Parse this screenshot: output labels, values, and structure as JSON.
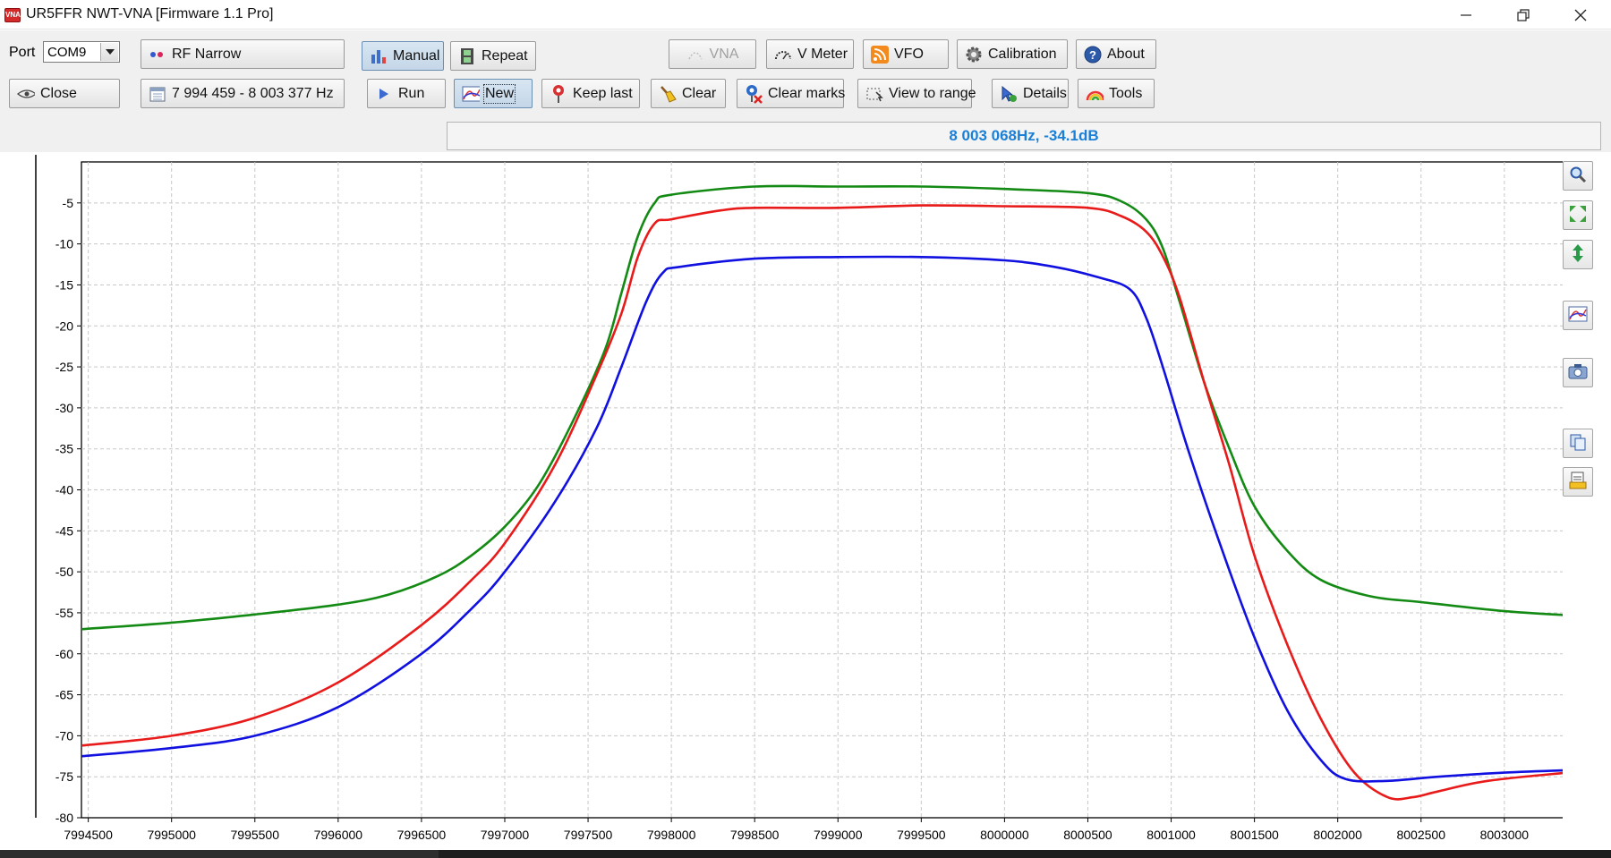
{
  "window": {
    "title": "UR5FFR NWT-VNA [Firmware 1.1 Pro]",
    "icon_text": "VNA"
  },
  "toolbar": {
    "port_label": "Port",
    "port_value": "COM9",
    "mode": "RF Narrow",
    "manual": "Manual",
    "repeat": "Repeat",
    "vna": "VNA",
    "vmeter": "V Meter",
    "vfo": "VFO",
    "calibration": "Calibration",
    "about": "About",
    "close": "Close",
    "range": "7 994 459 - 8 003 377 Hz",
    "run": "Run",
    "new": "New",
    "keep_last": "Keep last",
    "clear": "Clear",
    "clear_marks": "Clear marks",
    "view_to_range": "View to range",
    "details": "Details",
    "tools": "Tools"
  },
  "status": {
    "marker_readout": "8 003 068Hz, -34.1dB",
    "color": "#1a7fd6"
  },
  "colors": {
    "green": "#138a13",
    "red": "#e81a1a",
    "blue": "#1010e0",
    "grid": "#c8c8c8"
  },
  "chart_data": {
    "type": "line",
    "xlim": [
      7994459,
      7994459
    ],
    "ylim": [
      -80,
      0
    ],
    "x_ticks": [
      7994500,
      7995000,
      7995500,
      7996000,
      7996500,
      7997000,
      7997500,
      7998000,
      7998500,
      7999000,
      7999500,
      8000000,
      8000500,
      8001000,
      8001500,
      8002000,
      8002500,
      8003000
    ],
    "x_tick_labels": [
      "7994500",
      "7995000",
      "7995500",
      "7996000",
      "7996500",
      "7997000",
      "7997500",
      "7998000",
      "7998500",
      "7999000",
      "7999500",
      "8000000",
      "8000500",
      "8001000",
      "8001500",
      "8002000",
      "8002500",
      "8003000"
    ],
    "y_ticks": [
      -5,
      -10,
      -15,
      -20,
      -25,
      -30,
      -35,
      -40,
      -45,
      -50,
      -55,
      -60,
      -65,
      -70,
      -75,
      -80
    ],
    "y_tick_labels": [
      "-5",
      "-10",
      "-15",
      "-20",
      "-25",
      "-30",
      "-35",
      "-40",
      "-45",
      "-50",
      "-55",
      "-60",
      "-65",
      "-70",
      "-75",
      "-80"
    ],
    "grid": true,
    "series": [
      {
        "color": "#138a13",
        "points": [
          [
            7994459,
            -57.0
          ],
          [
            7995000,
            -56.2
          ],
          [
            7995500,
            -55.2
          ],
          [
            7996000,
            -54.0
          ],
          [
            7996300,
            -52.8
          ],
          [
            7996600,
            -50.5
          ],
          [
            7996800,
            -48.0
          ],
          [
            7997000,
            -44.5
          ],
          [
            7997200,
            -39.5
          ],
          [
            7997400,
            -32.0
          ],
          [
            7997600,
            -23.0
          ],
          [
            7997700,
            -16.0
          ],
          [
            7997800,
            -9.0
          ],
          [
            7997900,
            -5.0
          ],
          [
            7998000,
            -4.0
          ],
          [
            7998500,
            -3.0
          ],
          [
            7999000,
            -3.0
          ],
          [
            7999500,
            -3.0
          ],
          [
            8000000,
            -3.3
          ],
          [
            8000500,
            -3.8
          ],
          [
            8000700,
            -4.8
          ],
          [
            8000850,
            -7.0
          ],
          [
            8000950,
            -10.5
          ],
          [
            8001050,
            -17.0
          ],
          [
            8001200,
            -27.0
          ],
          [
            8001350,
            -35.0
          ],
          [
            8001500,
            -42.0
          ],
          [
            8001700,
            -47.5
          ],
          [
            8001900,
            -51.0
          ],
          [
            8002200,
            -53.0
          ],
          [
            8002500,
            -53.7
          ],
          [
            8003000,
            -54.8
          ],
          [
            8003377,
            -55.3
          ]
        ]
      },
      {
        "color": "#e81a1a",
        "points": [
          [
            7994459,
            -71.2
          ],
          [
            7995000,
            -70.0
          ],
          [
            7995500,
            -67.8
          ],
          [
            7996000,
            -63.5
          ],
          [
            7996500,
            -56.5
          ],
          [
            7996800,
            -51.0
          ],
          [
            7997000,
            -46.5
          ],
          [
            7997300,
            -37.0
          ],
          [
            7997550,
            -26.0
          ],
          [
            7997700,
            -18.5
          ],
          [
            7997800,
            -11.5
          ],
          [
            7997900,
            -7.5
          ],
          [
            7998000,
            -7.0
          ],
          [
            7998300,
            -5.9
          ],
          [
            7998500,
            -5.6
          ],
          [
            7999000,
            -5.6
          ],
          [
            7999500,
            -5.3
          ],
          [
            8000000,
            -5.4
          ],
          [
            8000500,
            -5.6
          ],
          [
            8000700,
            -6.6
          ],
          [
            8000850,
            -8.5
          ],
          [
            8000950,
            -11.5
          ],
          [
            8001050,
            -16.5
          ],
          [
            8001200,
            -27.0
          ],
          [
            8001350,
            -37.0
          ],
          [
            8001500,
            -48.0
          ],
          [
            8001700,
            -59.0
          ],
          [
            8001900,
            -68.0
          ],
          [
            8002100,
            -74.5
          ],
          [
            8002300,
            -77.5
          ],
          [
            8002450,
            -77.5
          ],
          [
            8002600,
            -76.8
          ],
          [
            8002900,
            -75.5
          ],
          [
            8003377,
            -74.5
          ]
        ]
      },
      {
        "color": "#1010e0",
        "points": [
          [
            7994459,
            -72.5
          ],
          [
            7995000,
            -71.5
          ],
          [
            7995500,
            -70.0
          ],
          [
            7996000,
            -66.5
          ],
          [
            7996500,
            -60.0
          ],
          [
            7996800,
            -54.5
          ],
          [
            7997000,
            -50.0
          ],
          [
            7997300,
            -41.5
          ],
          [
            7997550,
            -32.5
          ],
          [
            7997700,
            -25.0
          ],
          [
            7997850,
            -17.0
          ],
          [
            7997950,
            -13.5
          ],
          [
            7998050,
            -12.8
          ],
          [
            7998500,
            -11.8
          ],
          [
            7999000,
            -11.6
          ],
          [
            7999500,
            -11.6
          ],
          [
            8000000,
            -12.0
          ],
          [
            8000300,
            -12.8
          ],
          [
            8000550,
            -14.0
          ],
          [
            8000750,
            -15.5
          ],
          [
            8000850,
            -19.0
          ],
          [
            8000950,
            -25.0
          ],
          [
            8001100,
            -35.0
          ],
          [
            8001300,
            -47.0
          ],
          [
            8001500,
            -58.0
          ],
          [
            8001700,
            -67.0
          ],
          [
            8001900,
            -73.0
          ],
          [
            8002050,
            -75.3
          ],
          [
            8002300,
            -75.5
          ],
          [
            8002600,
            -75.0
          ],
          [
            8003000,
            -74.5
          ],
          [
            8003377,
            -74.2
          ]
        ]
      }
    ]
  }
}
